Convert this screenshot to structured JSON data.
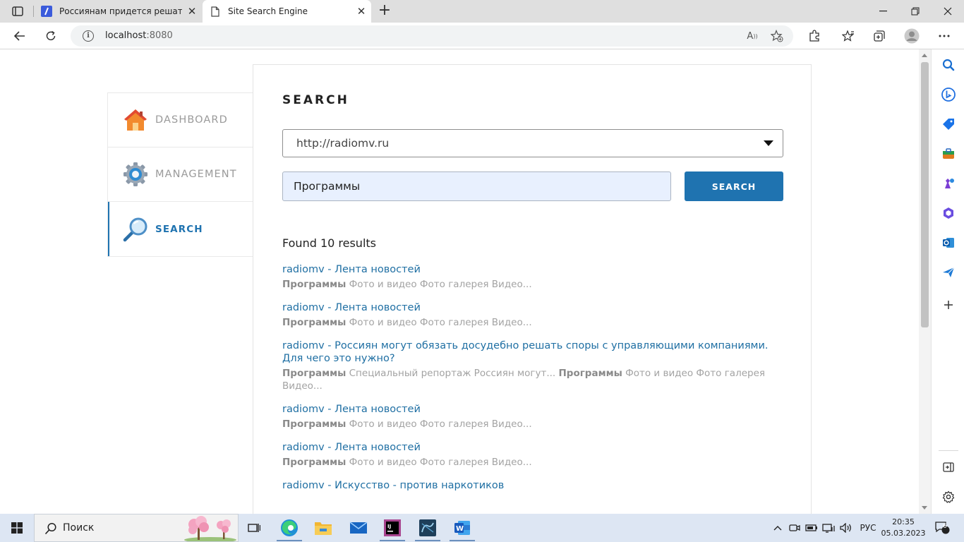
{
  "browser": {
    "tabs": [
      {
        "title": "Россиянам придется решать сп",
        "active": false,
        "favicon": "slash-app-icon"
      },
      {
        "title": "Site Search Engine",
        "active": true,
        "favicon": "page-icon"
      }
    ],
    "address": {
      "host": "localhost",
      "port": ":8080"
    },
    "window_controls": [
      "minimize-icon",
      "restore-icon",
      "close-icon"
    ],
    "toolbar_icons": [
      "read-aloud-icon",
      "add-favorite-icon",
      "extensions-icon",
      "favorites-icon",
      "collections-icon",
      "profile-icon",
      "more-icon"
    ],
    "side_panel_icons": [
      "search-icon",
      "bing-icon",
      "shopping-icon",
      "tools-icon",
      "games-icon",
      "office-icon",
      "outlook-icon",
      "send-icon",
      "add-icon",
      "sidebar-toggle-icon",
      "settings-icon"
    ]
  },
  "nav": {
    "items": [
      {
        "label": "DASHBOARD",
        "icon": "house-icon",
        "active": false
      },
      {
        "label": "MANAGEMENT",
        "icon": "gear-icon",
        "active": false
      },
      {
        "label": "SEARCH",
        "icon": "magnifier-icon",
        "active": true
      }
    ]
  },
  "search": {
    "heading": "SEARCH",
    "site_select": "http://radiomv.ru",
    "query": "Программы",
    "button_label": "SEARCH",
    "found_text": "Found 10 results"
  },
  "results": [
    {
      "title": "radiomv - Лента новостей",
      "snippet_parts": [
        {
          "b": true,
          "t": "Программы"
        },
        {
          "b": false,
          "t": " Фото и видео Фото галерея Видео..."
        }
      ]
    },
    {
      "title": "radiomv - Лента новостей",
      "snippet_parts": [
        {
          "b": true,
          "t": "Программы"
        },
        {
          "b": false,
          "t": " Фото и видео Фото галерея Видео..."
        }
      ]
    },
    {
      "title": "radiomv - Россиян могут обязать досудебно решать споры с управляющими компаниями. Для чего это нужно?",
      "snippet_parts": [
        {
          "b": true,
          "t": "Программы"
        },
        {
          "b": false,
          "t": " Специальный репортаж Россиян могут... "
        },
        {
          "b": true,
          "t": "Программы"
        },
        {
          "b": false,
          "t": " Фото и видео Фото галерея Видео..."
        }
      ]
    },
    {
      "title": "radiomv - Лента новостей",
      "snippet_parts": [
        {
          "b": true,
          "t": "Программы"
        },
        {
          "b": false,
          "t": " Фото и видео Фото галерея Видео..."
        }
      ]
    },
    {
      "title": "radiomv - Лента новостей",
      "snippet_parts": [
        {
          "b": true,
          "t": "Программы"
        },
        {
          "b": false,
          "t": " Фото и видео Фото галерея Видео..."
        }
      ]
    },
    {
      "title": "radiomv - Искусство - против наркотиков",
      "snippet_parts": []
    }
  ],
  "taskbar": {
    "search_placeholder": "Поиск",
    "apps": [
      "task-view-icon",
      "edge-icon",
      "file-explorer-icon",
      "mail-icon",
      "intellij-icon",
      "mysql-workbench-icon",
      "word-icon"
    ],
    "tray": {
      "language": "РУС",
      "time": "20:35",
      "date": "05.03.2023",
      "notifications": "6"
    }
  }
}
